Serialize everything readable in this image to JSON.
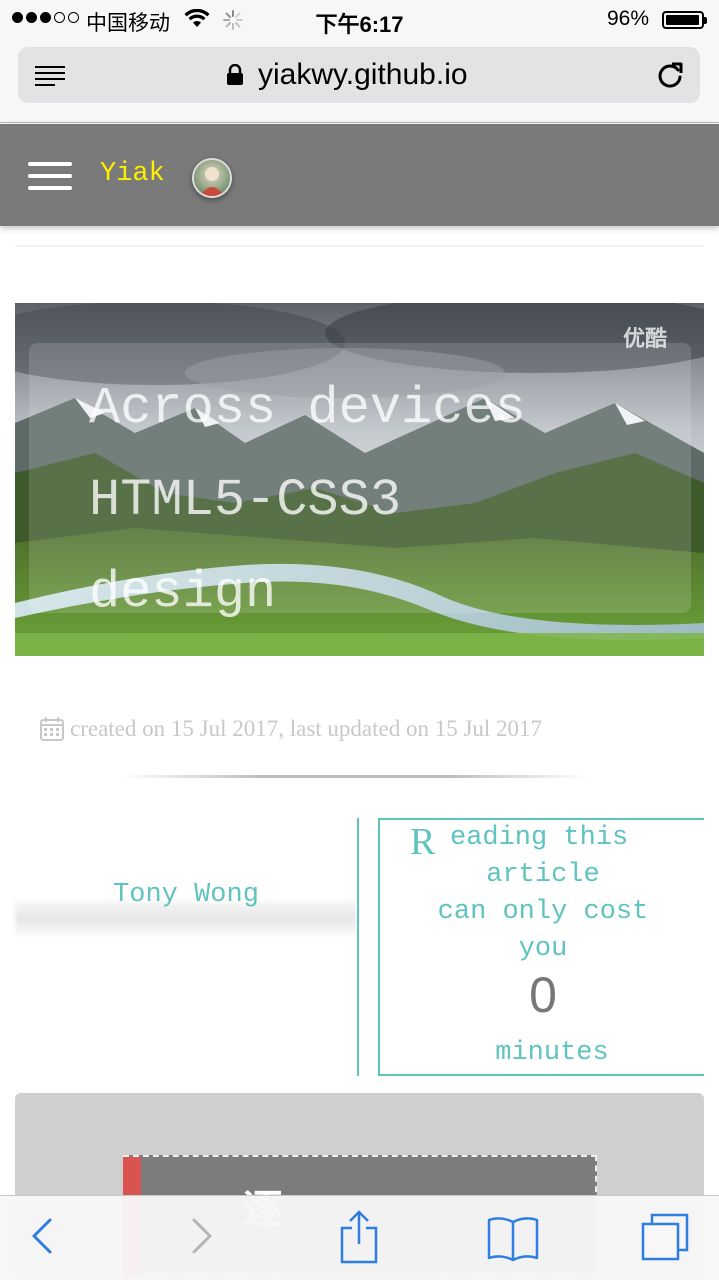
{
  "status_bar": {
    "carrier": "中国移动",
    "time": "下午6:17",
    "battery": "96%"
  },
  "browser": {
    "url": "yiakwy.github.io"
  },
  "site": {
    "brand": "Yiak"
  },
  "hero": {
    "title_lines": [
      "Across devices",
      "HTML5-CSS3",
      "design"
    ],
    "watermark": "优酷"
  },
  "post": {
    "meta": "created on 15 Jul 2017, last updated on 15 Jul 2017",
    "author": "Tony Wong",
    "reading": {
      "initial": "R",
      "line1": "eading this",
      "line2": "article",
      "line3": "can only cost",
      "line4": "you",
      "minutes": "0",
      "unit": "minutes"
    }
  },
  "card": {
    "glyph": "逐"
  },
  "colors": {
    "accent_teal": "#5fc4bd",
    "brand_yellow": "#ffee00",
    "header_gray": "#7a7a7a",
    "safari_blue": "#2f7de1"
  }
}
